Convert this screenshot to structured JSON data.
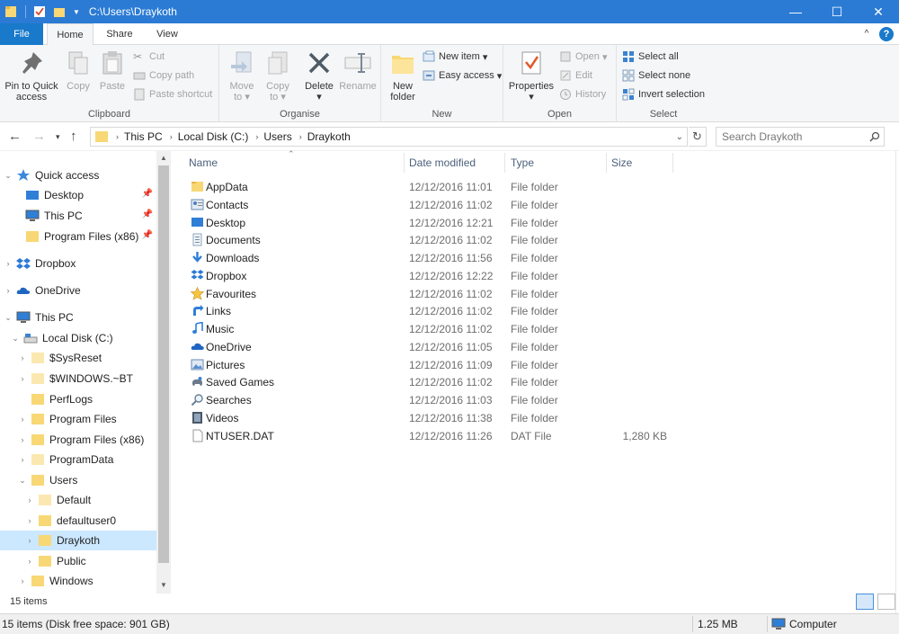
{
  "window": {
    "title": "C:\\Users\\Draykoth",
    "minimize_glyph": "—",
    "maximize_glyph": "☐",
    "close_glyph": "✕"
  },
  "tabs": {
    "file": "File",
    "home": "Home",
    "share": "Share",
    "view": "View",
    "help_glyph": "?",
    "collapse_glyph": "^"
  },
  "ribbon": {
    "clipboard": {
      "label": "Clipboard",
      "pin_line1": "Pin to Quick",
      "pin_line2": "access",
      "copy": "Copy",
      "paste": "Paste",
      "cut": "Cut",
      "copy_path": "Copy path",
      "paste_shortcut": "Paste shortcut"
    },
    "organise": {
      "label": "Organise",
      "move_to": "Move",
      "move_to2": "to",
      "copy_to": "Copy",
      "copy_to2": "to",
      "delete": "Delete",
      "rename": "Rename"
    },
    "new": {
      "label": "New",
      "new_folder1": "New",
      "new_folder2": "folder",
      "new_item": "New item",
      "easy_access": "Easy access"
    },
    "open": {
      "label": "Open",
      "properties": "Properties",
      "open": "Open",
      "edit": "Edit",
      "history": "History"
    },
    "select": {
      "label": "Select",
      "select_all": "Select all",
      "select_none": "Select none",
      "invert": "Invert selection"
    }
  },
  "address": {
    "crumbs": [
      "This PC",
      "Local Disk (C:)",
      "Users",
      "Draykoth"
    ],
    "search_placeholder": "Search Draykoth"
  },
  "navpane": {
    "quick_access": "Quick access",
    "qa_items": [
      "Desktop",
      "This PC",
      "Program Files (x86)"
    ],
    "dropbox": "Dropbox",
    "onedrive": "OneDrive",
    "this_pc": "This PC",
    "local_disk": "Local Disk (C:)",
    "disk_folders": [
      "$SysReset",
      "$WINDOWS.~BT",
      "PerfLogs",
      "Program Files",
      "Program Files (x86)",
      "ProgramData",
      "Users"
    ],
    "user_folders": [
      "Default",
      "defaultuser0",
      "Draykoth",
      "Public"
    ],
    "windows": "Windows"
  },
  "columns": {
    "name": "Name",
    "date": "Date modified",
    "type": "Type",
    "size": "Size"
  },
  "files": [
    {
      "name": "AppData",
      "date": "12/12/2016 11:01",
      "type": "File folder",
      "size": "",
      "icon": "folder-icon"
    },
    {
      "name": "Contacts",
      "date": "12/12/2016 11:02",
      "type": "File folder",
      "size": "",
      "icon": "contacts-icon"
    },
    {
      "name": "Desktop",
      "date": "12/12/2016 12:21",
      "type": "File folder",
      "size": "",
      "icon": "desktop-icon"
    },
    {
      "name": "Documents",
      "date": "12/12/2016 11:02",
      "type": "File folder",
      "size": "",
      "icon": "documents-icon"
    },
    {
      "name": "Downloads",
      "date": "12/12/2016 11:56",
      "type": "File folder",
      "size": "",
      "icon": "downloads-icon"
    },
    {
      "name": "Dropbox",
      "date": "12/12/2016 12:22",
      "type": "File folder",
      "size": "",
      "icon": "dropbox-icon"
    },
    {
      "name": "Favourites",
      "date": "12/12/2016 11:02",
      "type": "File folder",
      "size": "",
      "icon": "star-icon"
    },
    {
      "name": "Links",
      "date": "12/12/2016 11:02",
      "type": "File folder",
      "size": "",
      "icon": "links-icon"
    },
    {
      "name": "Music",
      "date": "12/12/2016 11:02",
      "type": "File folder",
      "size": "",
      "icon": "music-icon"
    },
    {
      "name": "OneDrive",
      "date": "12/12/2016 11:05",
      "type": "File folder",
      "size": "",
      "icon": "onedrive-icon"
    },
    {
      "name": "Pictures",
      "date": "12/12/2016 11:09",
      "type": "File folder",
      "size": "",
      "icon": "pictures-icon"
    },
    {
      "name": "Saved Games",
      "date": "12/12/2016 11:02",
      "type": "File folder",
      "size": "",
      "icon": "saved-games-icon"
    },
    {
      "name": "Searches",
      "date": "12/12/2016 11:03",
      "type": "File folder",
      "size": "",
      "icon": "search-icon"
    },
    {
      "name": "Videos",
      "date": "12/12/2016 11:38",
      "type": "File folder",
      "size": "",
      "icon": "videos-icon"
    },
    {
      "name": "NTUSER.DAT",
      "date": "12/12/2016 11:26",
      "type": "DAT File",
      "size": "1,280 KB",
      "icon": "file-icon"
    }
  ],
  "status": {
    "item_count": "15 items",
    "bar_left": "15 items (Disk free space: 901 GB)",
    "bar_size": "1.25 MB",
    "bar_computer": "Computer"
  },
  "colors": {
    "titlebar": "#2b7bd5",
    "file_tab": "#1979ca",
    "folder": "#f8d775",
    "selected": "#cce8ff"
  }
}
